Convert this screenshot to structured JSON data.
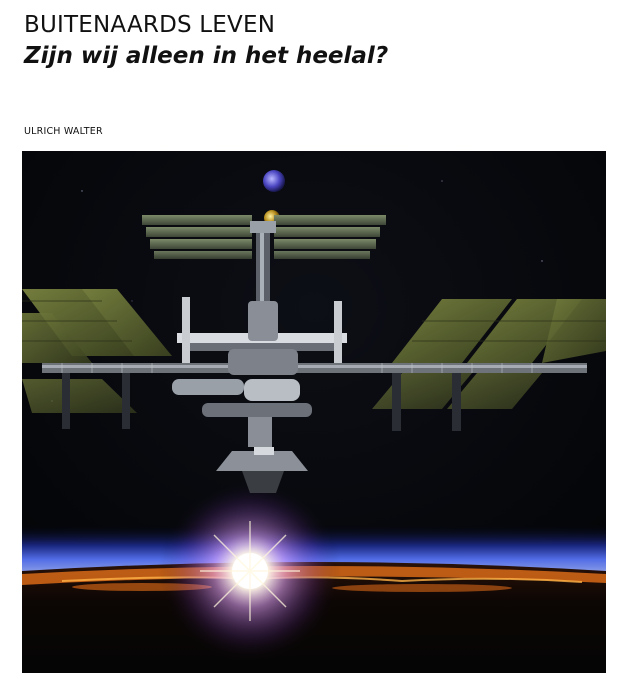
{
  "article": {
    "title": "BUITENAARDS LEVEN",
    "subtitle": "Zijn wij alleen in het heelal?",
    "author": "ULRICH WALTER"
  },
  "photo": {
    "subject": "space-station-above-earth-sunrise",
    "colors": {
      "space": "#050609",
      "solar_panel": "#5f6830",
      "atmosphere": "#3a55d6",
      "sun": "#ffffff",
      "horizon_fire": "#d86a18"
    }
  }
}
